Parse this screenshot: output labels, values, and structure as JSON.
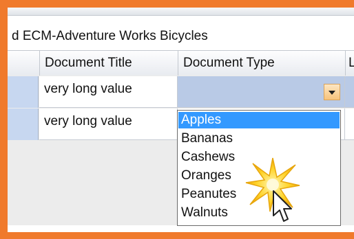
{
  "window": {
    "title": "d ECM-Adventure Works Bicycles"
  },
  "columns": [
    {
      "label": "Document Title"
    },
    {
      "label": "Document Type"
    },
    {
      "label": "L"
    }
  ],
  "rows": [
    {
      "document_title": "very long value",
      "document_type": ""
    },
    {
      "document_title": "very long value",
      "document_type": ""
    }
  ],
  "dropdown": {
    "selected": "Apples",
    "options": [
      "Apples",
      "Bananas",
      "Cashews",
      "Oranges",
      "Peanutes",
      "Walnuts"
    ]
  },
  "colors": {
    "frame_orange": "#f07a2c",
    "selection_blue": "#3399ff",
    "row_header": "#c7d7f0"
  },
  "icons": {
    "combo_arrow": "chevron-down-icon",
    "cursor": "mouse-pointer-icon",
    "highlight": "click-sparkle-icon"
  }
}
